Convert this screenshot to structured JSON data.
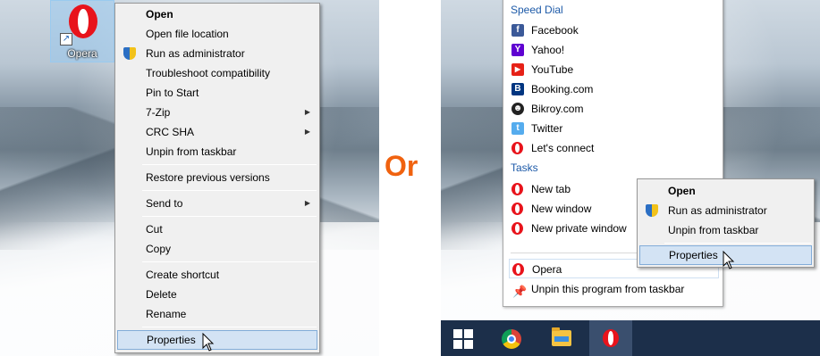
{
  "desktop_icon": {
    "label": "Opera"
  },
  "context_menu": {
    "items": [
      {
        "label": "Open",
        "bold": true
      },
      {
        "label": "Open file location"
      },
      {
        "label": "Run as administrator",
        "icon": "uac-shield-icon"
      },
      {
        "label": "Troubleshoot compatibility"
      },
      {
        "label": "Pin to Start"
      },
      {
        "label": "7-Zip",
        "submenu": true
      },
      {
        "label": "CRC SHA",
        "submenu": true
      },
      {
        "label": "Unpin from taskbar"
      },
      {
        "label": "Restore previous versions"
      },
      {
        "label": "Send to",
        "submenu": true
      },
      {
        "label": "Cut"
      },
      {
        "label": "Copy"
      },
      {
        "label": "Create shortcut"
      },
      {
        "label": "Delete"
      },
      {
        "label": "Rename"
      },
      {
        "label": "Properties",
        "highlighted": true
      }
    ]
  },
  "separator_text": "Or",
  "jump_list": {
    "speed_dial_heading": "Speed Dial",
    "speed_dial": [
      {
        "label": "Facebook",
        "icon": "facebook-icon",
        "color": "#3b5998",
        "glyph": "f"
      },
      {
        "label": "Yahoo!",
        "icon": "yahoo-icon",
        "color": "#5f01d1",
        "glyph": "Y"
      },
      {
        "label": "YouTube",
        "icon": "youtube-icon",
        "color": "#e62117",
        "glyph": "▶"
      },
      {
        "label": "Booking.com",
        "icon": "booking-icon",
        "color": "#003580",
        "glyph": "B"
      },
      {
        "label": "Bikroy.com",
        "icon": "bikroy-icon",
        "color": "#222222",
        "glyph": "☻"
      },
      {
        "label": "Twitter",
        "icon": "twitter-icon",
        "color": "#55acee",
        "glyph": "t"
      },
      {
        "label": "Let's connect",
        "icon": "opera-icon",
        "color": "#e8131b",
        "glyph": ""
      }
    ],
    "tasks_heading": "Tasks",
    "tasks": [
      {
        "label": "New tab"
      },
      {
        "label": "New window"
      },
      {
        "label": "New private window"
      }
    ],
    "app_item": "Opera",
    "unpin_item": "Unpin this program from taskbar"
  },
  "context_menu_2": {
    "items": [
      {
        "label": "Open",
        "bold": true
      },
      {
        "label": "Run as administrator",
        "icon": "uac-shield-icon"
      },
      {
        "label": "Unpin from taskbar"
      },
      {
        "label": "Properties",
        "highlighted": true
      }
    ]
  },
  "taskbar": {
    "buttons": [
      "start-icon",
      "chrome-icon",
      "file-explorer-icon",
      "opera-icon"
    ]
  }
}
